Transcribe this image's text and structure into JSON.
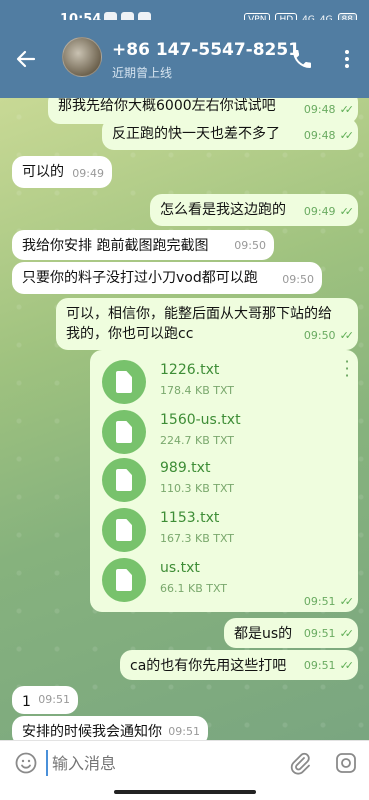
{
  "status_bar": {
    "time": "10:54",
    "vpn": "VPN",
    "hd": "HD",
    "net1": "4G",
    "net2": "4G",
    "battery": "88"
  },
  "header": {
    "title": "+86 147-5547-8251",
    "subtitle": "近期曾上线",
    "back_icon": "arrow-left-icon",
    "call_icon": "phone-icon",
    "more_icon": "more-vertical-icon"
  },
  "messages": [
    {
      "dir": "out",
      "text": "那我先给你大概6000左右你试试吧",
      "time": "09:48"
    },
    {
      "dir": "out",
      "text": "反正跑的快一天也差不多了",
      "time": "09:48"
    },
    {
      "dir": "in",
      "text": "可以的",
      "time": "09:49"
    },
    {
      "dir": "out",
      "text": "怎么看是我这边跑的",
      "time": "09:49"
    },
    {
      "dir": "in",
      "text": "我给你安排  跑前截图跑完截图",
      "time": "09:50"
    },
    {
      "dir": "in",
      "text": "只要你的料子没打过小刀vod都可以跑",
      "time": "09:50"
    },
    {
      "dir": "out",
      "line1": "可以，相信你，能整后面从大哥那下站的给",
      "line2": "我的，你也可以跑cc",
      "time": "09:50"
    },
    {
      "dir": "out",
      "text": "都是us的",
      "time": "09:51"
    },
    {
      "dir": "out",
      "text": "ca的也有你先用这些打吧",
      "time": "09:51"
    },
    {
      "dir": "in",
      "text": "1",
      "time": "09:51"
    },
    {
      "dir": "in",
      "text": "安排的时候我会通知你",
      "time": "09:51"
    }
  ],
  "files": {
    "time": "09:51",
    "items": [
      {
        "name": "1226.txt",
        "size": "178.4 KB TXT"
      },
      {
        "name": "1560-us.txt",
        "size": "224.7 KB TXT"
      },
      {
        "name": "989.txt",
        "size": "110.3 KB TXT"
      },
      {
        "name": "1153.txt",
        "size": "167.3 KB TXT"
      },
      {
        "name": "us.txt",
        "size": "66.1 KB TXT"
      }
    ]
  },
  "composer": {
    "placeholder": "输入消息",
    "emoji_icon": "emoji-icon",
    "attach_icon": "paperclip-icon",
    "camera_icon": "camera-icon"
  },
  "colors": {
    "header": "#517da2",
    "out_bubble": "#effdde",
    "in_bubble": "#ffffff",
    "accent_green": "#5fae56"
  }
}
